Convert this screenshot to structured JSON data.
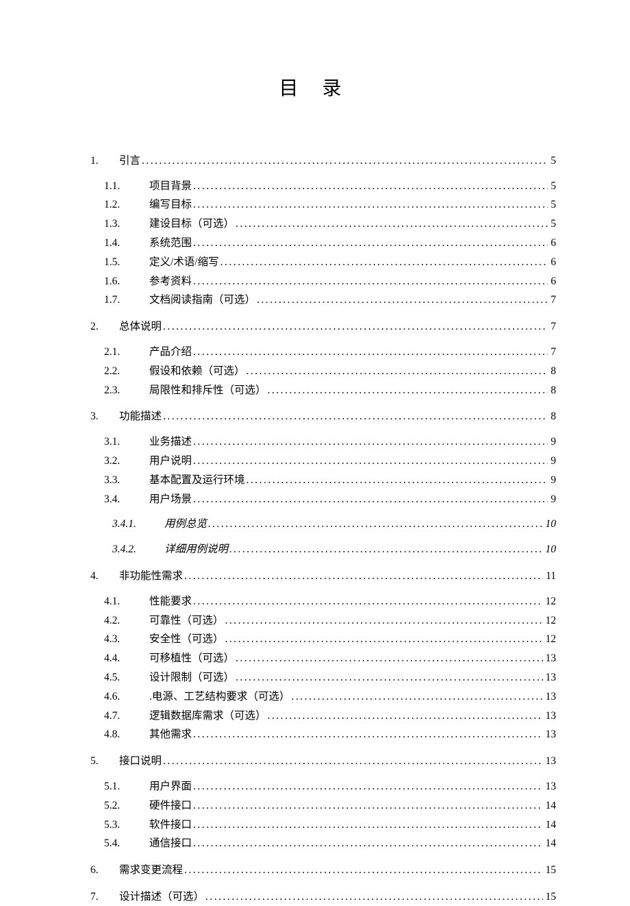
{
  "title": "目 录",
  "toc": [
    {
      "level": 1,
      "num": "1.",
      "text": "引言",
      "page": "5"
    },
    {
      "level": 2,
      "num": "1.1.",
      "text": "项目背景",
      "page": "5",
      "first": true
    },
    {
      "level": 2,
      "num": "1.2.",
      "text": "编写目标",
      "page": "5"
    },
    {
      "level": 2,
      "num": "1.3.",
      "text": "建设目标（可选）",
      "page": "5"
    },
    {
      "level": 2,
      "num": "1.4.",
      "text": "系统范围",
      "page": "6"
    },
    {
      "level": 2,
      "num": "1.5.",
      "text": "定义/术语/缩写 ",
      "page": "6"
    },
    {
      "level": 2,
      "num": "1.6.",
      "text": "参考资料",
      "page": "6"
    },
    {
      "level": 2,
      "num": "1.7.",
      "text": "文档阅读指南（可选）",
      "page": "7"
    },
    {
      "level": 1,
      "num": "2.",
      "text": "总体说明",
      "page": "7",
      "gap": true
    },
    {
      "level": 2,
      "num": "2.1.",
      "text": "产品介绍",
      "page": "7",
      "first": true
    },
    {
      "level": 2,
      "num": "2.2.",
      "text": "假设和依赖（可选）",
      "page": "8"
    },
    {
      "level": 2,
      "num": "2.3.",
      "text": "局限性和排斥性（可选）",
      "page": "8"
    },
    {
      "level": 1,
      "num": "3.",
      "text": "功能描述",
      "page": "8",
      "gap": true
    },
    {
      "level": 2,
      "num": "3.1.",
      "text": "业务描述",
      "page": "9",
      "first": true
    },
    {
      "level": 2,
      "num": "3.2.",
      "text": "用户说明",
      "page": "9"
    },
    {
      "level": 2,
      "num": "3.3.",
      "text": "基本配置及运行环境",
      "page": "9"
    },
    {
      "level": 2,
      "num": "3.4.",
      "text": "用户场景",
      "page": "9"
    },
    {
      "level": 3,
      "num": "3.4.1.",
      "text": "用例总览",
      "page": "10"
    },
    {
      "level": 3,
      "num": "3.4.2.",
      "text": "详细用例说明",
      "page": "10"
    },
    {
      "level": 1,
      "num": "4.",
      "text": "非功能性需求",
      "page": "11",
      "gap": true
    },
    {
      "level": 2,
      "num": "4.1.",
      "text": "性能要求",
      "page": "12",
      "first": true
    },
    {
      "level": 2,
      "num": "4.2.",
      "text": "可靠性（可选）",
      "page": "12"
    },
    {
      "level": 2,
      "num": "4.3.",
      "text": "安全性（可选）",
      "page": "12"
    },
    {
      "level": 2,
      "num": "4.4.",
      "text": "可移植性（可选）",
      "page": "13"
    },
    {
      "level": 2,
      "num": "4.5.",
      "text": "设计限制（可选）",
      "page": "13"
    },
    {
      "level": 2,
      "num": "4.6.",
      "text": ".电源、工艺结构要求（可选） ",
      "page": "13"
    },
    {
      "level": 2,
      "num": "4.7.",
      "text": "逻辑数据库需求（可选）",
      "page": "13"
    },
    {
      "level": 2,
      "num": "4.8.",
      "text": "其他需求",
      "page": "13"
    },
    {
      "level": 1,
      "num": "5.",
      "text": "接口说明",
      "page": "13",
      "gap": true
    },
    {
      "level": 2,
      "num": "5.1.",
      "text": "用户界面",
      "page": "13",
      "first": true
    },
    {
      "level": 2,
      "num": "5.2.",
      "text": "硬件接口",
      "page": "14"
    },
    {
      "level": 2,
      "num": "5.3.",
      "text": "软件接口",
      "page": "14"
    },
    {
      "level": 2,
      "num": "5.4.",
      "text": "通信接口",
      "page": "14"
    },
    {
      "level": 1,
      "num": "6.",
      "text": "需求变更流程",
      "page": "15",
      "gap": true
    },
    {
      "level": 1,
      "num": "7.",
      "text": "设计描述（可选）",
      "page": "15",
      "gap": true
    }
  ]
}
